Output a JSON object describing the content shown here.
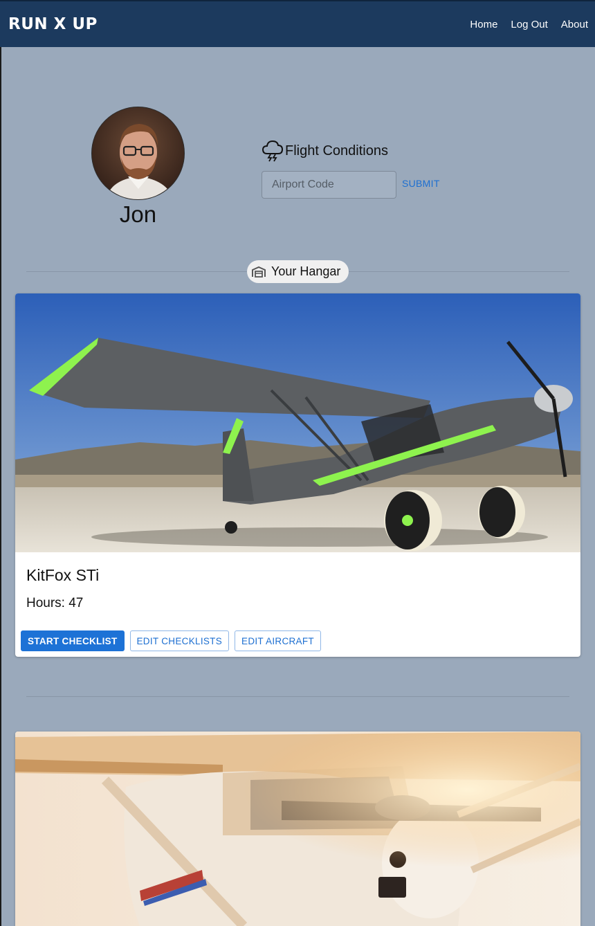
{
  "nav": {
    "brand": "RUN X UP",
    "links": [
      "Home",
      "Log Out",
      "About"
    ]
  },
  "profile": {
    "name": "Jon"
  },
  "conditions": {
    "title": "Flight Conditions",
    "icon": "storm-cloud-icon",
    "airport_placeholder": "Airport Code",
    "submit_label": "SUBMIT"
  },
  "hangar": {
    "label": "Your Hangar",
    "icon": "garage-icon"
  },
  "aircraft": [
    {
      "name": "KitFox STi",
      "hours": "Hours: 47",
      "actions": [
        "START CHECKLIST",
        "EDIT CHECKLISTS",
        "EDIT AIRCRAFT"
      ]
    }
  ],
  "colors": {
    "navbar": "#1c3a5e",
    "page_bg": "#9aa9bb",
    "primary": "#1d72d6"
  }
}
